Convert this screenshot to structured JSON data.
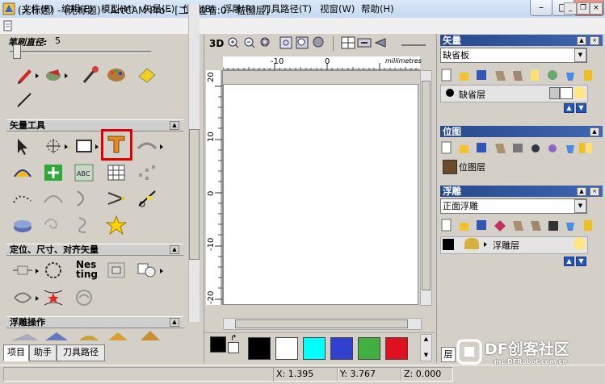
{
  "window": {
    "title": "(无标题) - (无标题) - ArtCAM Pro - [二维查看:0 - 位图层]",
    "min": "–",
    "max": "□",
    "close": "×"
  },
  "menu": [
    "文件(F)",
    "编辑(E)",
    "模型(M)",
    "矢量(E)",
    "位图(B)",
    "浮雕(R)",
    "刀具路径(T)",
    "视窗(W)",
    "帮助(H)"
  ],
  "left": {
    "brush_label": "笔刷直径:",
    "brush_value": "5",
    "section_vector_tools": "矢量工具",
    "nest_label_line1": "Nes",
    "nest_label_line2": "ting",
    "section_position": "定位、尺寸、对齐矢量",
    "section_relief_ops": "浮雕操作",
    "tabs": [
      "项目",
      "助手",
      "刀具路径"
    ]
  },
  "view2d": {
    "mode_3d": "3D",
    "units": "millimetres",
    "hruler_ticks": [
      "-10",
      "0",
      "10"
    ],
    "vruler_ticks": [
      "20",
      "10",
      "0",
      "-10",
      "-20"
    ]
  },
  "colors": {
    "swatches": [
      "#000000",
      "#ffffff",
      "#00ffff",
      "#3040d0",
      "#40b040",
      "#e01020"
    ],
    "selected_primary": "#000000",
    "accent_header": "#3a5fa8",
    "highlight": "#e00000"
  },
  "right": {
    "vector": {
      "title": "矢量",
      "sheet": "缺省板",
      "layer": "缺省层"
    },
    "bitmap": {
      "title": "位图",
      "layer": "位图层"
    },
    "relief": {
      "title": "浮雕",
      "relief_name": "正面浮雕",
      "layer": "浮雕层"
    }
  },
  "bottom_right_tab": "层",
  "status": {
    "x": "X: 1.395",
    "y": "Y: 3.767",
    "z": "Z: 0.000"
  },
  "watermark": "DF创客社区",
  "watermark_sub": "mc.DFRobot.com.cn"
}
